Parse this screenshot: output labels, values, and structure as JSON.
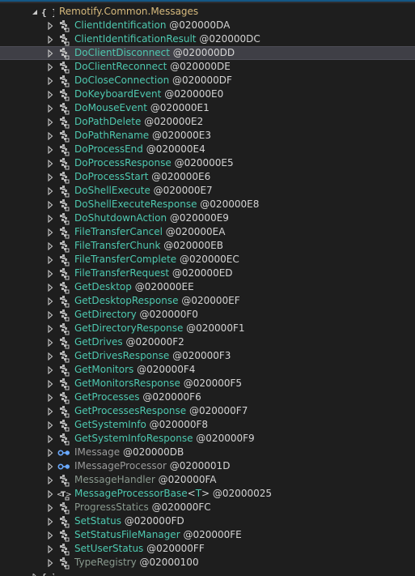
{
  "namespace": {
    "label": "Remotify.Common.Messages",
    "icon": "namespace-icon"
  },
  "items": [
    {
      "name": "ClientIdentification",
      "token": "@020000DA",
      "kind": "class",
      "style": "class"
    },
    {
      "name": "ClientIdentificationResult",
      "token": "@020000DC",
      "kind": "class",
      "style": "class"
    },
    {
      "name": "DoClientDisconnect",
      "token": "@020000DD",
      "kind": "class",
      "style": "class",
      "selected": true
    },
    {
      "name": "DoClientReconnect",
      "token": "@020000DE",
      "kind": "class",
      "style": "class"
    },
    {
      "name": "DoCloseConnection",
      "token": "@020000DF",
      "kind": "class",
      "style": "class"
    },
    {
      "name": "DoKeyboardEvent",
      "token": "@020000E0",
      "kind": "class",
      "style": "class"
    },
    {
      "name": "DoMouseEvent",
      "token": "@020000E1",
      "kind": "class",
      "style": "class"
    },
    {
      "name": "DoPathDelete",
      "token": "@020000E2",
      "kind": "class",
      "style": "class"
    },
    {
      "name": "DoPathRename",
      "token": "@020000E3",
      "kind": "class",
      "style": "class"
    },
    {
      "name": "DoProcessEnd",
      "token": "@020000E4",
      "kind": "class",
      "style": "class"
    },
    {
      "name": "DoProcessResponse",
      "token": "@020000E5",
      "kind": "class",
      "style": "class"
    },
    {
      "name": "DoProcessStart",
      "token": "@020000E6",
      "kind": "class",
      "style": "class"
    },
    {
      "name": "DoShellExecute",
      "token": "@020000E7",
      "kind": "class",
      "style": "class"
    },
    {
      "name": "DoShellExecuteResponse",
      "token": "@020000E8",
      "kind": "class",
      "style": "class"
    },
    {
      "name": "DoShutdownAction",
      "token": "@020000E9",
      "kind": "class",
      "style": "class"
    },
    {
      "name": "FileTransferCancel",
      "token": "@020000EA",
      "kind": "class",
      "style": "class"
    },
    {
      "name": "FileTransferChunk",
      "token": "@020000EB",
      "kind": "class",
      "style": "class"
    },
    {
      "name": "FileTransferComplete",
      "token": "@020000EC",
      "kind": "class",
      "style": "class"
    },
    {
      "name": "FileTransferRequest",
      "token": "@020000ED",
      "kind": "class",
      "style": "class"
    },
    {
      "name": "GetDesktop",
      "token": "@020000EE",
      "kind": "class",
      "style": "class"
    },
    {
      "name": "GetDesktopResponse",
      "token": "@020000EF",
      "kind": "class",
      "style": "class"
    },
    {
      "name": "GetDirectory",
      "token": "@020000F0",
      "kind": "class",
      "style": "class"
    },
    {
      "name": "GetDirectoryResponse",
      "token": "@020000F1",
      "kind": "class",
      "style": "class"
    },
    {
      "name": "GetDrives",
      "token": "@020000F2",
      "kind": "class",
      "style": "class"
    },
    {
      "name": "GetDrivesResponse",
      "token": "@020000F3",
      "kind": "class",
      "style": "class"
    },
    {
      "name": "GetMonitors",
      "token": "@020000F4",
      "kind": "class",
      "style": "class"
    },
    {
      "name": "GetMonitorsResponse",
      "token": "@020000F5",
      "kind": "class",
      "style": "class"
    },
    {
      "name": "GetProcesses",
      "token": "@020000F6",
      "kind": "class",
      "style": "class"
    },
    {
      "name": "GetProcessesResponse",
      "token": "@020000F7",
      "kind": "class",
      "style": "class"
    },
    {
      "name": "GetSystemInfo",
      "token": "@020000F8",
      "kind": "class",
      "style": "class"
    },
    {
      "name": "GetSystemInfoResponse",
      "token": "@020000F9",
      "kind": "class",
      "style": "class"
    },
    {
      "name": "IMessage",
      "token": "@020000DB",
      "kind": "interface",
      "style": "gray"
    },
    {
      "name": "IMessageProcessor",
      "token": "@0200001D",
      "kind": "interface",
      "style": "gray"
    },
    {
      "name": "MessageHandler",
      "token": "@020000FA",
      "kind": "static-class",
      "style": "dim"
    },
    {
      "name": "MessageProcessorBase",
      "generic": "T",
      "token": "@02000025",
      "kind": "generic-class",
      "style": "class"
    },
    {
      "name": "ProgressStatics",
      "token": "@020000FC",
      "kind": "static-class",
      "style": "dim"
    },
    {
      "name": "SetStatus",
      "token": "@020000FD",
      "kind": "class",
      "style": "class"
    },
    {
      "name": "SetStatusFileManager",
      "token": "@020000FE",
      "kind": "class",
      "style": "class"
    },
    {
      "name": "SetUserStatus",
      "token": "@020000FF",
      "kind": "class",
      "style": "class"
    },
    {
      "name": "TypeRegistry",
      "token": "@02000100",
      "kind": "static-class",
      "style": "dim"
    }
  ],
  "next_namespace": {
    "label": "",
    "icon": "namespace-icon"
  },
  "colors": {
    "background": "#1e1e1e",
    "class_name": "#4ec9b0",
    "namespace_name": "#d7ba7d",
    "interface_name": "#9b9b9b",
    "static_class_name": "#8a9a8f",
    "selection": "#3f3f46"
  }
}
